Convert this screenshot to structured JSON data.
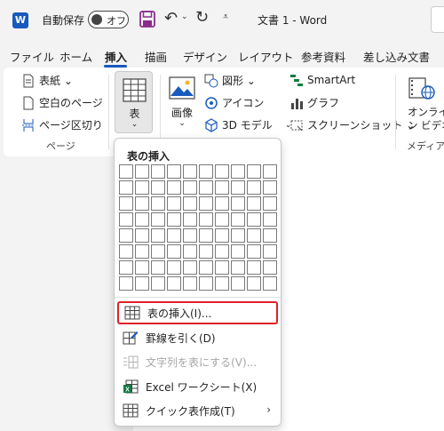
{
  "titlebar": {
    "app_logo_letter": "W",
    "autosave_label": "自動保存",
    "autosave_state": "オフ",
    "qat_more": "⩡",
    "document_title": "文書 1  -  Word"
  },
  "tabs": [
    {
      "label": "ファイル"
    },
    {
      "label": "ホーム"
    },
    {
      "label": "挿入"
    },
    {
      "label": "描画"
    },
    {
      "label": "デザイン"
    },
    {
      "label": "レイアウト"
    },
    {
      "label": "参考資料"
    },
    {
      "label": "差し込み文書"
    }
  ],
  "ribbon": {
    "pages_group": {
      "cover_page": "表紙 ⌄",
      "blank_page": "空白のページ",
      "page_break": "ページ区切り",
      "label": "ページ"
    },
    "table_button": {
      "label": "表",
      "caret": "⌄"
    },
    "illustrations": {
      "picture_label": "画像",
      "picture_caret": "⌄",
      "shapes": "図形 ⌄",
      "icons": "アイコン",
      "models_3d": "3D モデル",
      "models_caret": "⌄",
      "smartart": "SmartArt",
      "chart": "グラフ",
      "screenshot": "スクリーンショット ⌄"
    },
    "media": {
      "online_video_line1": "オンライ",
      "online_video_line2": "ン ビデオ",
      "label": "メディア"
    }
  },
  "dropdown": {
    "title": "表の挿入",
    "grid_rows": 8,
    "grid_cols": 10,
    "items": [
      {
        "label": "表の挿入(I)...",
        "icon": "table-grid-icon"
      },
      {
        "label": "罫線を引く(D)",
        "icon": "pencil-grid-icon"
      },
      {
        "label": "文字列を表にする(V)...",
        "icon": "text-to-table-icon"
      },
      {
        "label": "Excel ワークシート(X)",
        "icon": "excel-icon"
      },
      {
        "label": "クイック表作成(T)",
        "icon": "table-grid-icon",
        "arrow": "›"
      }
    ]
  },
  "colors": {
    "accent": "#185abd",
    "highlight": "#e0202a",
    "excel": "#107c41"
  }
}
